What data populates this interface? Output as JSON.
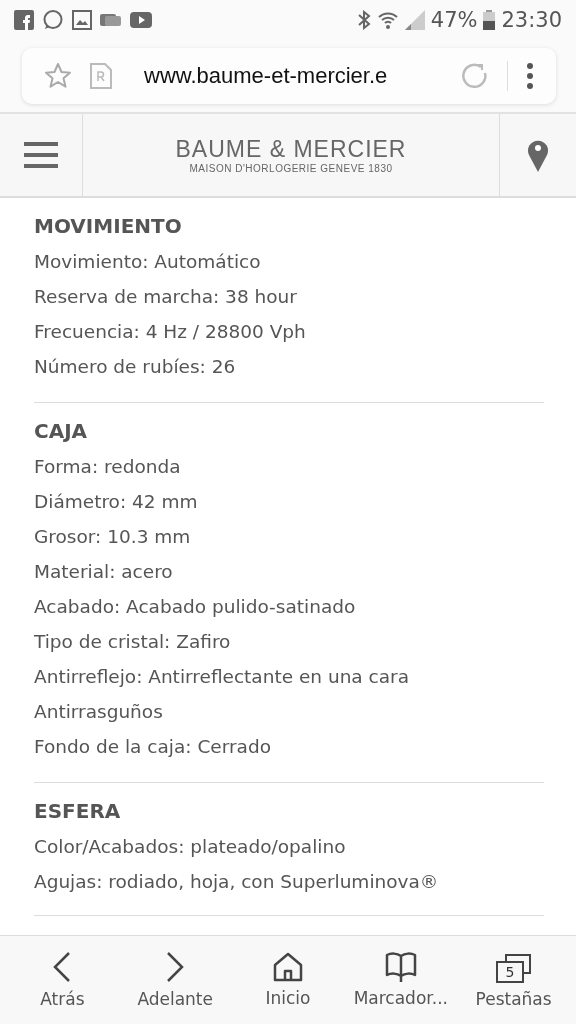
{
  "status_bar": {
    "battery": "47%",
    "time": "23:30"
  },
  "address_bar": {
    "url": "www.baume-et-mercier.e"
  },
  "site_header": {
    "brand": "BAUME & MERCIER",
    "tagline": "MAISON D'HORLOGERIE GENEVE 1830"
  },
  "sections": [
    {
      "title": "MOVIMIENTO",
      "lines": [
        "Movimiento: Automático",
        "Reserva de marcha: 38 hour",
        "Frecuencia: 4 Hz / 28800 Vph",
        "Número de rubíes: 26"
      ]
    },
    {
      "title": "CAJA",
      "lines": [
        "Forma: redonda",
        "Diámetro: 42 mm",
        "Grosor: 10.3 mm",
        "Material: acero",
        "Acabado: Acabado pulido-satinado",
        "Tipo de cristal: Zafiro",
        "Antirreflejo: Antirreflectante en una cara",
        "Antirrasguños",
        "Fondo de la caja: Cerrado"
      ]
    },
    {
      "title": "ESFERA",
      "lines": [
        "Color/Acabados: plateado/opalino",
        "Agujas: rodiado, hoja, con Superluminova®"
      ]
    }
  ],
  "bottom_nav": [
    {
      "kind": "back",
      "label": "Atrás"
    },
    {
      "kind": "forward",
      "label": "Adelante"
    },
    {
      "kind": "home",
      "label": "Inicio"
    },
    {
      "kind": "bookmarks",
      "label": "Marcador..."
    },
    {
      "kind": "tabs",
      "label": "Pestañas",
      "count": "5"
    }
  ]
}
